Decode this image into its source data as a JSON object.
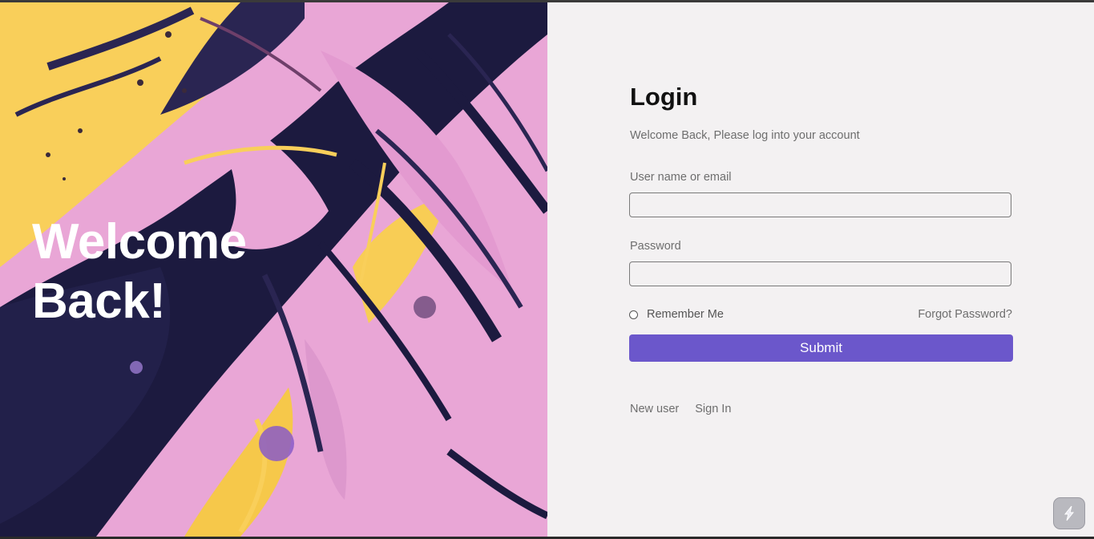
{
  "hero": {
    "line1": "Welcome",
    "line2": "Back!"
  },
  "login": {
    "title": "Login",
    "subtitle": "Welcome Back, Please log into your account",
    "username_label": "User name or email",
    "username_value": "",
    "password_label": "Password",
    "password_value": "",
    "remember_label": "Remember Me",
    "forgot_label": "Forgot Password?",
    "submit_label": "Submit"
  },
  "footer": {
    "new_user_label": "New user",
    "sign_in_label": "Sign In"
  },
  "icons": {
    "remember": "radio-icon",
    "widget": "extension-icon"
  },
  "colors": {
    "accent": "#6b57cb",
    "panel_bg": "#f3f1f2",
    "hero_pink": "#e9a6d6",
    "hero_navy": "#1c1a3f",
    "hero_yellow": "#f9cf5a"
  }
}
